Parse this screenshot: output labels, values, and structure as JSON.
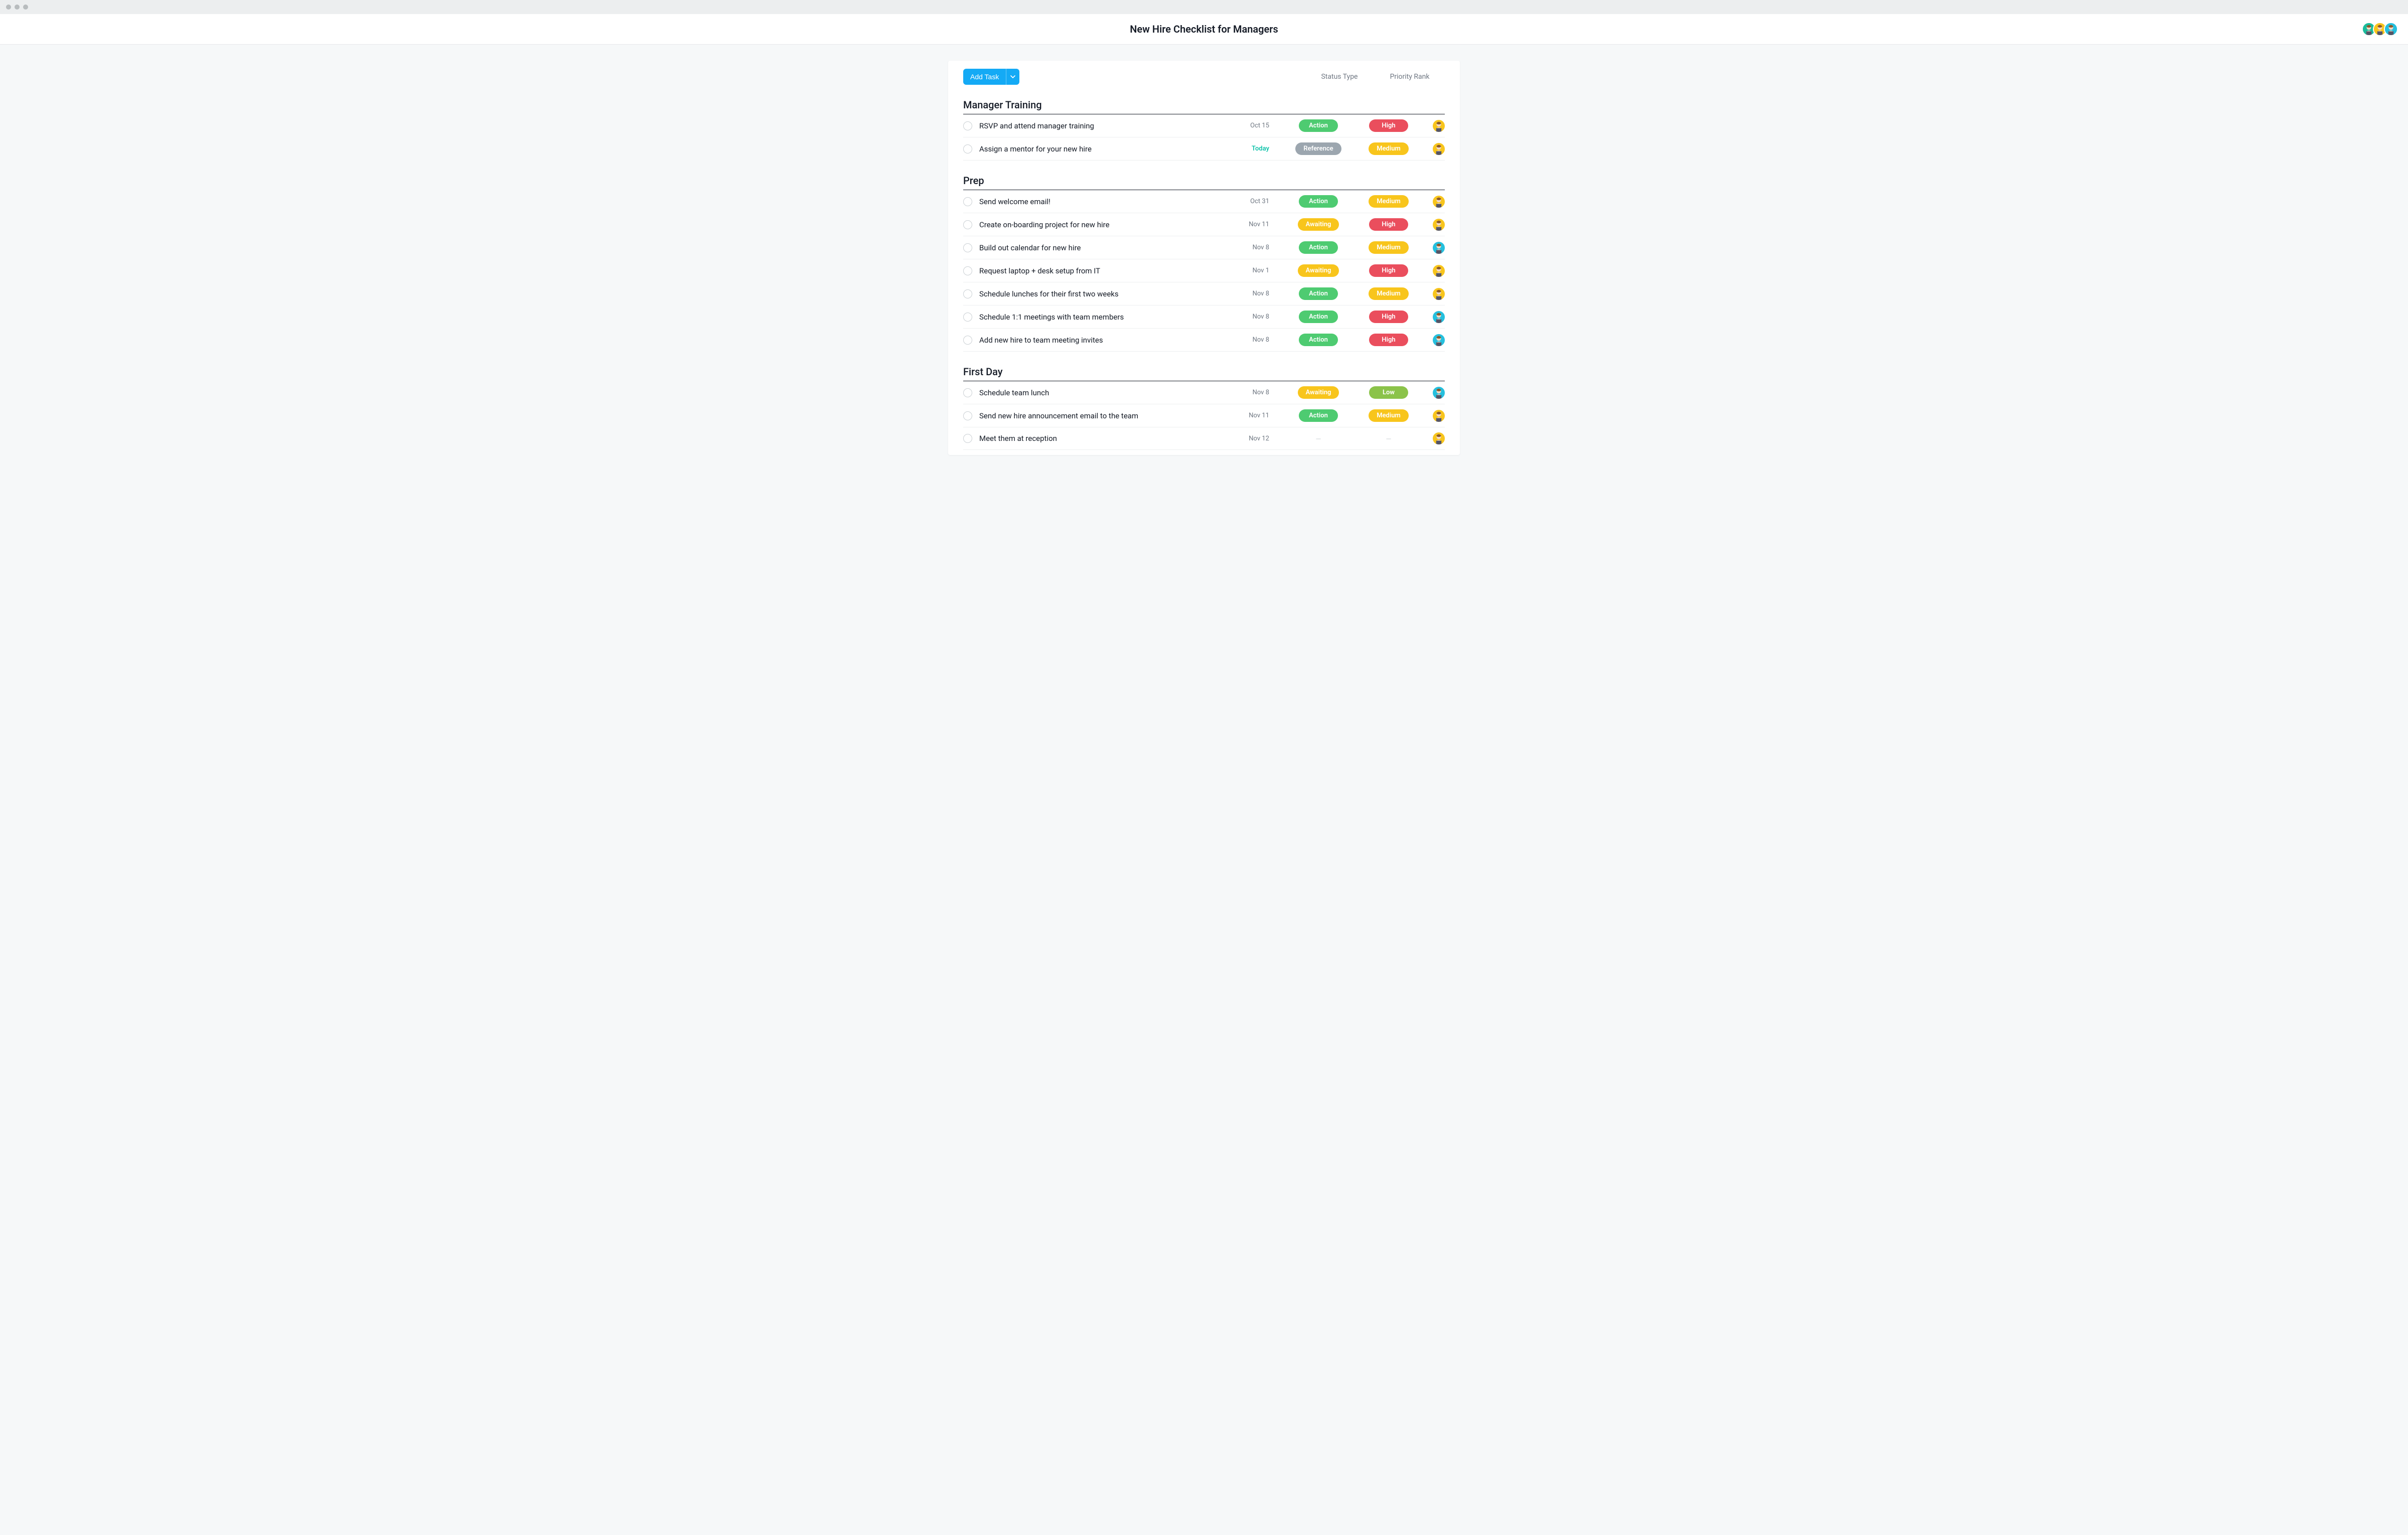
{
  "header": {
    "title": "New Hire Checklist for Managers"
  },
  "toolbar": {
    "add_task_label": "Add Task"
  },
  "columns": {
    "status": "Status Type",
    "priority": "Priority Rank"
  },
  "pills": {
    "status": {
      "action": {
        "label": "Action",
        "color": "#4ecb71"
      },
      "reference": {
        "label": "Reference",
        "color": "#9ca6af"
      },
      "awaiting": {
        "label": "Awaiting",
        "color": "#f8c51c"
      }
    },
    "priority": {
      "high": {
        "label": "High",
        "color": "#ea4e5d"
      },
      "medium": {
        "label": "Medium",
        "color": "#f8c51c"
      },
      "low": {
        "label": "Low",
        "color": "#8bc34a"
      }
    }
  },
  "avatars": {
    "teal-1": "#1abc9c",
    "yellow-1": "#f8c51c",
    "cyan-1": "#25c0de"
  },
  "header_avatars": [
    "teal-1",
    "yellow-1",
    "cyan-1"
  ],
  "sections": [
    {
      "title": "Manager Training",
      "tasks": [
        {
          "name": "RSVP and attend manager training",
          "date": "Oct 15",
          "date_kind": "normal",
          "status": "action",
          "priority": "high",
          "assignee": "yellow-1"
        },
        {
          "name": "Assign a mentor for your new hire",
          "date": "Today",
          "date_kind": "today",
          "status": "reference",
          "priority": "medium",
          "assignee": "yellow-1"
        }
      ]
    },
    {
      "title": "Prep",
      "tasks": [
        {
          "name": "Send welcome email!",
          "date": "Oct 31",
          "date_kind": "normal",
          "status": "action",
          "priority": "medium",
          "assignee": "yellow-1"
        },
        {
          "name": "Create on-boarding project for new hire",
          "date": "Nov 11",
          "date_kind": "normal",
          "status": "awaiting",
          "priority": "high",
          "assignee": "yellow-1"
        },
        {
          "name": "Build out calendar for new hire",
          "date": "Nov 8",
          "date_kind": "normal",
          "status": "action",
          "priority": "medium",
          "assignee": "cyan-1"
        },
        {
          "name": "Request laptop + desk setup from IT",
          "date": "Nov 1",
          "date_kind": "normal",
          "status": "awaiting",
          "priority": "high",
          "assignee": "yellow-1"
        },
        {
          "name": "Schedule lunches for their first two weeks",
          "date": "Nov 8",
          "date_kind": "normal",
          "status": "action",
          "priority": "medium",
          "assignee": "yellow-1"
        },
        {
          "name": "Schedule 1:1 meetings with team members",
          "date": "Nov 8",
          "date_kind": "normal",
          "status": "action",
          "priority": "high",
          "assignee": "cyan-1"
        },
        {
          "name": "Add new hire to team meeting invites",
          "date": "Nov 8",
          "date_kind": "normal",
          "status": "action",
          "priority": "high",
          "assignee": "cyan-1"
        }
      ]
    },
    {
      "title": "First Day",
      "tasks": [
        {
          "name": "Schedule team lunch",
          "date": "Nov 8",
          "date_kind": "normal",
          "status": "awaiting",
          "priority": "low",
          "assignee": "cyan-1"
        },
        {
          "name": "Send new hire announcement email to the team",
          "date": "Nov 11",
          "date_kind": "normal",
          "status": "action",
          "priority": "medium",
          "assignee": "yellow-1"
        },
        {
          "name": "Meet them at reception",
          "date": "Nov 12",
          "date_kind": "normal",
          "status": null,
          "priority": null,
          "assignee": "yellow-1"
        }
      ]
    }
  ]
}
